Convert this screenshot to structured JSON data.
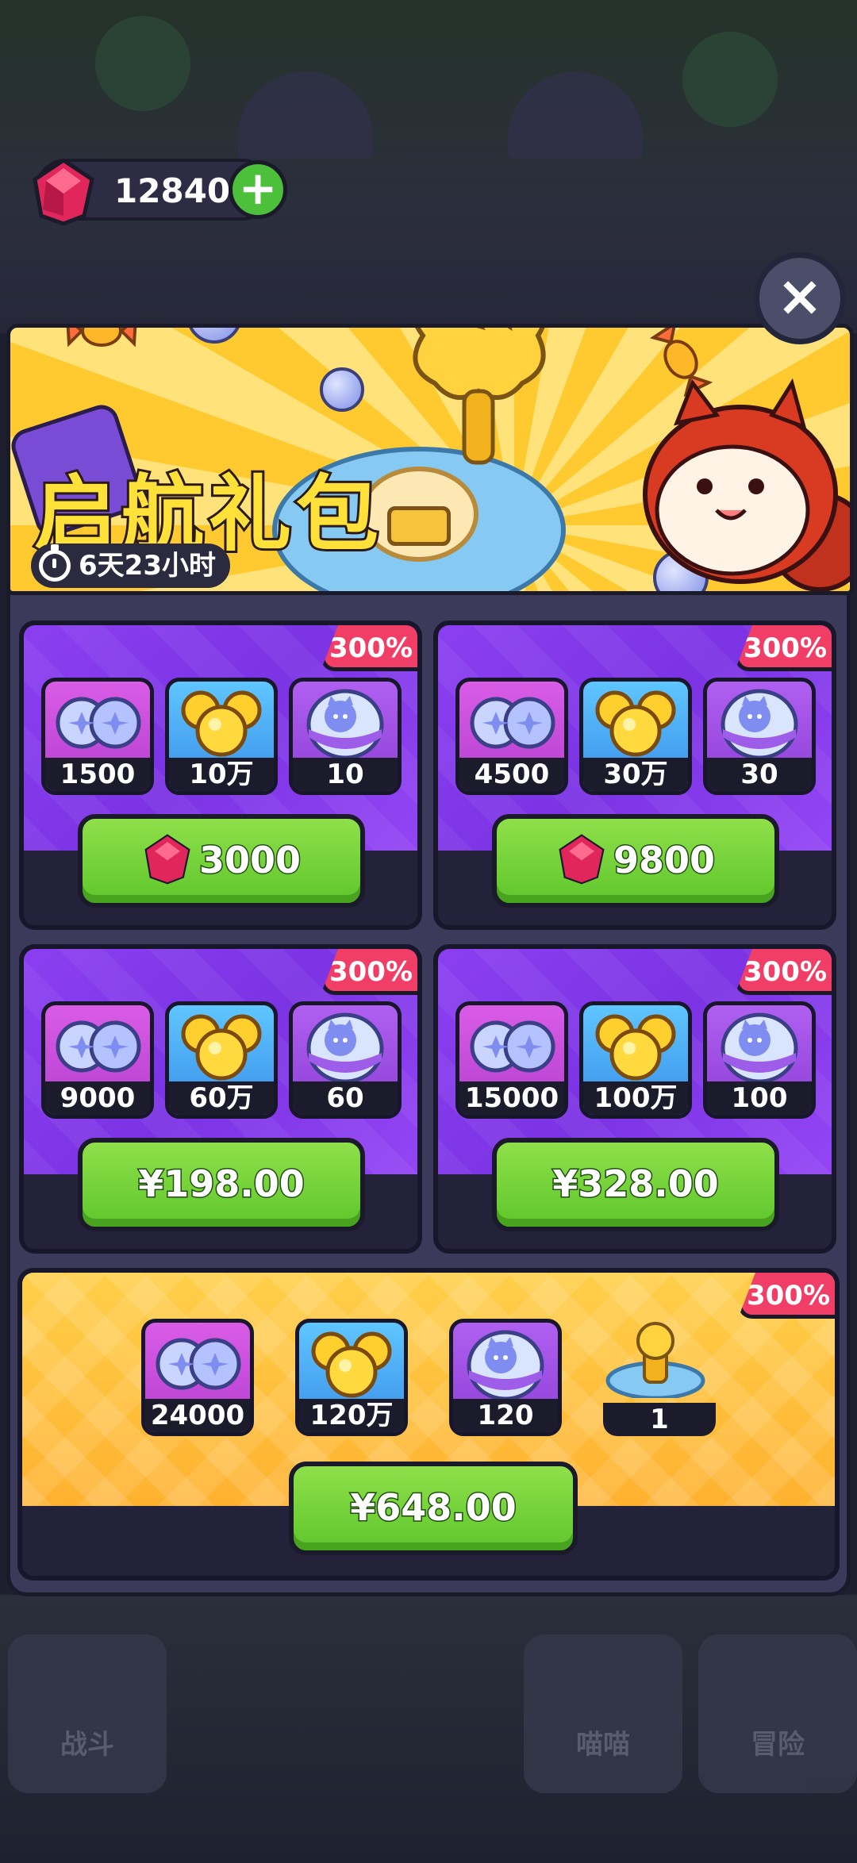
{
  "currency": {
    "amount": "12840"
  },
  "banner": {
    "title": "启航礼包",
    "timer": "6天23小时"
  },
  "packs": [
    {
      "badge": "300%",
      "items": [
        "1500",
        "10万",
        "10"
      ],
      "price": "3000",
      "price_type": "gem"
    },
    {
      "badge": "300%",
      "items": [
        "4500",
        "30万",
        "30"
      ],
      "price": "9800",
      "price_type": "gem"
    },
    {
      "badge": "300%",
      "items": [
        "9000",
        "60万",
        "60"
      ],
      "price": "¥198.00",
      "price_type": "cash"
    },
    {
      "badge": "300%",
      "items": [
        "15000",
        "100万",
        "100"
      ],
      "price": "¥328.00",
      "price_type": "cash"
    }
  ],
  "big_pack": {
    "badge": "300%",
    "items": [
      "24000",
      "120万",
      "120",
      "1"
    ],
    "price": "¥648.00"
  },
  "colors": {
    "gem": "#e0265a",
    "buy_green": "#6ccb32",
    "badge_red": "#f03e66",
    "purple_card": "#8b3ff0",
    "gold_card": "#ffc040"
  },
  "icons": [
    "gem-icon",
    "plus-icon",
    "close-icon",
    "clock-icon",
    "blue-orbs-icon",
    "gold-coins-icon",
    "cat-egg-icon",
    "fountain-icon"
  ],
  "background_nav": {
    "left": "战斗",
    "middle": "喵喵",
    "right": "冒险"
  }
}
